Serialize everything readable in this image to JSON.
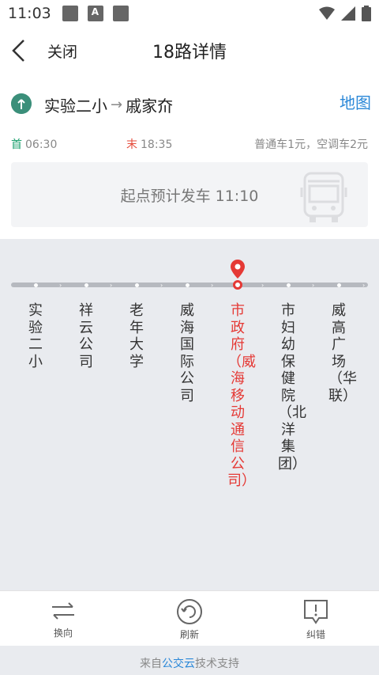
{
  "status_bar": {
    "time": "11:03"
  },
  "header": {
    "close_label": "关闭",
    "title": "18路详情"
  },
  "route": {
    "from": "实验二小",
    "arrow": "→",
    "to": "戚家夼",
    "map_label": "地图"
  },
  "schedule": {
    "first_label": "首",
    "first_time": "06:30",
    "last_label": "末",
    "last_time": "18:35",
    "fare": "普通车1元，空调车2元"
  },
  "depart_info": "起点预计发车 11:10",
  "stops": [
    {
      "name": "实验二小"
    },
    {
      "name": "祥云公司"
    },
    {
      "name": "老年大学"
    },
    {
      "name": "威海国际公司"
    },
    {
      "name": "市政府（威海移动通信公司）",
      "current": true
    },
    {
      "name": "市妇幼保健院（北洋集团）"
    },
    {
      "name": "威高广场（华联）"
    }
  ],
  "bottom_actions": {
    "switch_label": "换向",
    "refresh_label": "刷新",
    "report_label": "纠错"
  },
  "footer": {
    "prefix": "来自",
    "brand": "公交云",
    "suffix": "技术支持"
  },
  "colors": {
    "accent": "#2b88d8",
    "current_stop": "#e53935",
    "first_green": "#1aa06e",
    "last_red": "#e54a3a"
  }
}
